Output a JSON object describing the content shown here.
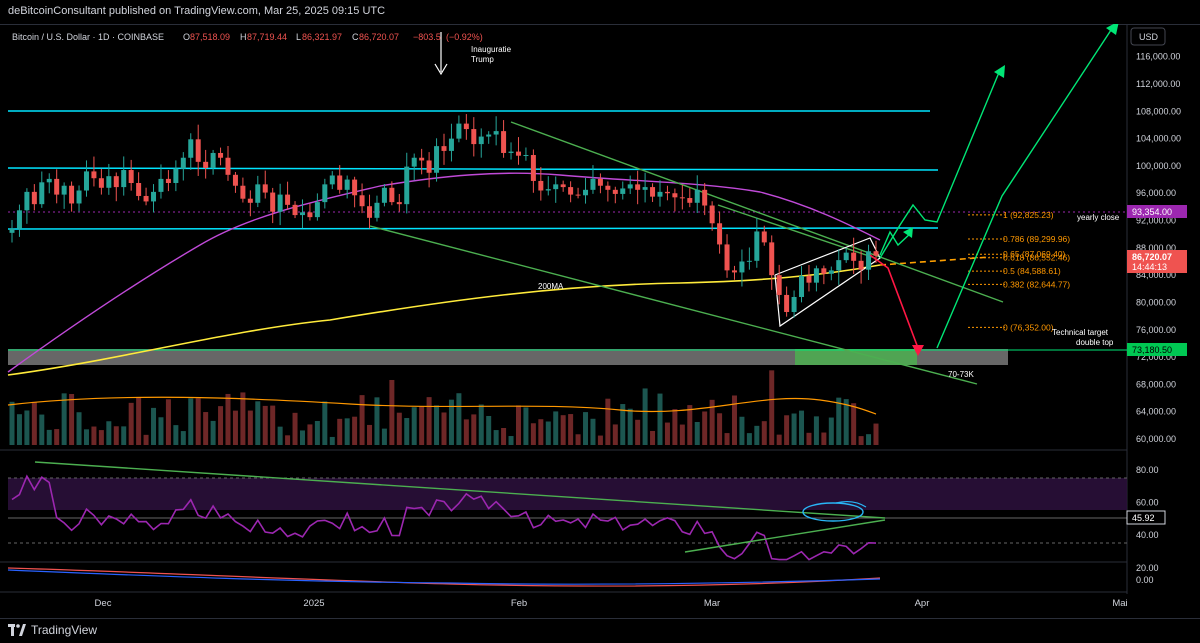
{
  "header": {
    "publisher_line": "deBitcoinConsultant published on TradingView.com, Mar 25, 2025 09:15 UTC"
  },
  "legend": {
    "symbol": "Bitcoin / U.S. Dollar · 1D · COINBASE",
    "o_label": "O",
    "o_value": "87,518.09",
    "h_label": "H",
    "h_value": "87,719.44",
    "l_label": "L",
    "l_value": "86,321.97",
    "c_label": "C",
    "c_value": "86,720.07",
    "change": "−803.5",
    "change_pct": "(−0.92%)"
  },
  "currency": "USD",
  "footer": {
    "brand": "TradingView"
  },
  "colors": {
    "up": "#26a69a",
    "down": "#ef5350",
    "cyan": "#00e5ff",
    "green": "#00e676",
    "magenta": "#b04cc8",
    "yellow": "#ffeb3b",
    "fib": "#ff9800",
    "purple_level": "#9c27b0"
  },
  "chart_data": {
    "type": "candlestick",
    "xlabels": [
      "Dec",
      "2025",
      "Feb",
      "Mar",
      "Apr",
      "Mai"
    ],
    "price_ticks": [
      "116,000.00",
      "112,000.00",
      "108,000.00",
      "104,000.00",
      "100,000.00",
      "96,000.00",
      "92,000.00",
      "88,000.00",
      "84,000.00",
      "80,000.00",
      "76,000.00",
      "72,000.00",
      "68,000.00",
      "64,000.00",
      "60,000.00"
    ],
    "price_range": [
      59000,
      120000
    ],
    "rsi_ticks": [
      "80.00",
      "60.00",
      "40.00",
      "20.00",
      "0.00"
    ],
    "rsi_value": "45.92",
    "last_price": "86,720.07",
    "countdown": "14:44:13",
    "yearly_close_price": "93,354.00",
    "level_73k": "73,180.50",
    "annotations": {
      "inauguration": "Inauguratie",
      "inauguration2": "Trump",
      "ma200": "200MA",
      "yearly_close": "yearly close",
      "technical_target": "Technical target",
      "double_top": "double top",
      "zone": "70-73K"
    },
    "fib_levels": [
      {
        "label": "1 (92,825.23)",
        "price": 92825.23
      },
      {
        "label": "0.786 (89,299.96)",
        "price": 89299.96
      },
      {
        "label": "0.65 (87,069.40)",
        "price": 87069.4
      },
      {
        "label": "0.618 (86,552.46)",
        "price": 86552.46
      },
      {
        "label": "0.5 (84,588.61)",
        "price": 84588.61
      },
      {
        "label": "0.382 (82,644.77)",
        "price": 82644.77
      },
      {
        "label": "0 (76,352.00)",
        "price": 76352.0
      }
    ],
    "closes": [
      90800,
      93500,
      96200,
      94400,
      97600,
      98100,
      95800,
      97100,
      94500,
      96400,
      99200,
      98200,
      96800,
      98500,
      96900,
      99400,
      97500,
      95600,
      94800,
      96200,
      98100,
      97500,
      99600,
      101200,
      103900,
      100600,
      99700,
      101900,
      101200,
      98700,
      97100,
      95200,
      94600,
      97300,
      96100,
      93300,
      95800,
      94300,
      92800,
      93200,
      92500,
      94700,
      97300,
      98600,
      96500,
      98000,
      95700,
      94100,
      92400,
      94600,
      96800,
      94700,
      94400,
      99900,
      101200,
      100800,
      99000,
      102900,
      102200,
      104000,
      106200,
      105400,
      103200,
      104300,
      104600,
      105100,
      101900,
      102100,
      101500,
      101600,
      97800,
      96400,
      96600,
      97300,
      96900,
      95800,
      95700,
      96500,
      98100,
      97100,
      96500,
      95900,
      96700,
      97300,
      96500,
      96900,
      95500,
      96200,
      96000,
      95400,
      95300,
      94600,
      96500,
      94200,
      91600,
      88500,
      84700,
      84400,
      86000,
      86100,
      90400,
      88800,
      84000,
      81100,
      78600,
      80800,
      83900,
      82900,
      85000,
      84200,
      84700,
      86200,
      87300,
      86100,
      84800,
      87500,
      86850
    ]
  }
}
